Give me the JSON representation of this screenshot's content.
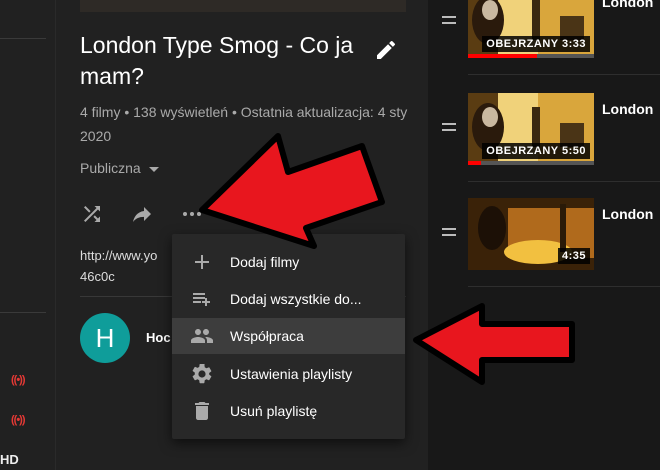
{
  "playlist": {
    "title": "London Type Smog - Co ja mam?",
    "meta": "4 filmy • 138 wyświetleń • Ostatnia aktualizacja: 4 sty 2020",
    "privacy": "Publiczna",
    "description_line1": "http://www.yo",
    "description_line2": "46c0c",
    "owner_initial": "H",
    "owner_name": "Hoc"
  },
  "menu": {
    "items": [
      {
        "label": "Dodaj filmy",
        "icon": "plus-icon"
      },
      {
        "label": "Dodaj wszystkie do...",
        "icon": "playlist-add-icon"
      },
      {
        "label": "Współpraca",
        "icon": "people-icon"
      },
      {
        "label": "Ustawienia playlisty",
        "icon": "gear-icon"
      },
      {
        "label": "Usuń playlistę",
        "icon": "trash-icon"
      }
    ],
    "active_index": 2
  },
  "videos": [
    {
      "title": "London",
      "badge": "OBEJRZANY 3:33",
      "progress": 0.55
    },
    {
      "title": "London",
      "badge": "OBEJRZANY 5:50",
      "progress": 0.1
    },
    {
      "title": "London",
      "badge": "4:35",
      "progress": 0
    }
  ],
  "sidebar": {
    "hd_label": "HD",
    "live_icon": "((•))"
  },
  "colors": {
    "accent_red": "#e8161e",
    "avatar": "#0f9d9a",
    "progress": "#ff0000"
  }
}
